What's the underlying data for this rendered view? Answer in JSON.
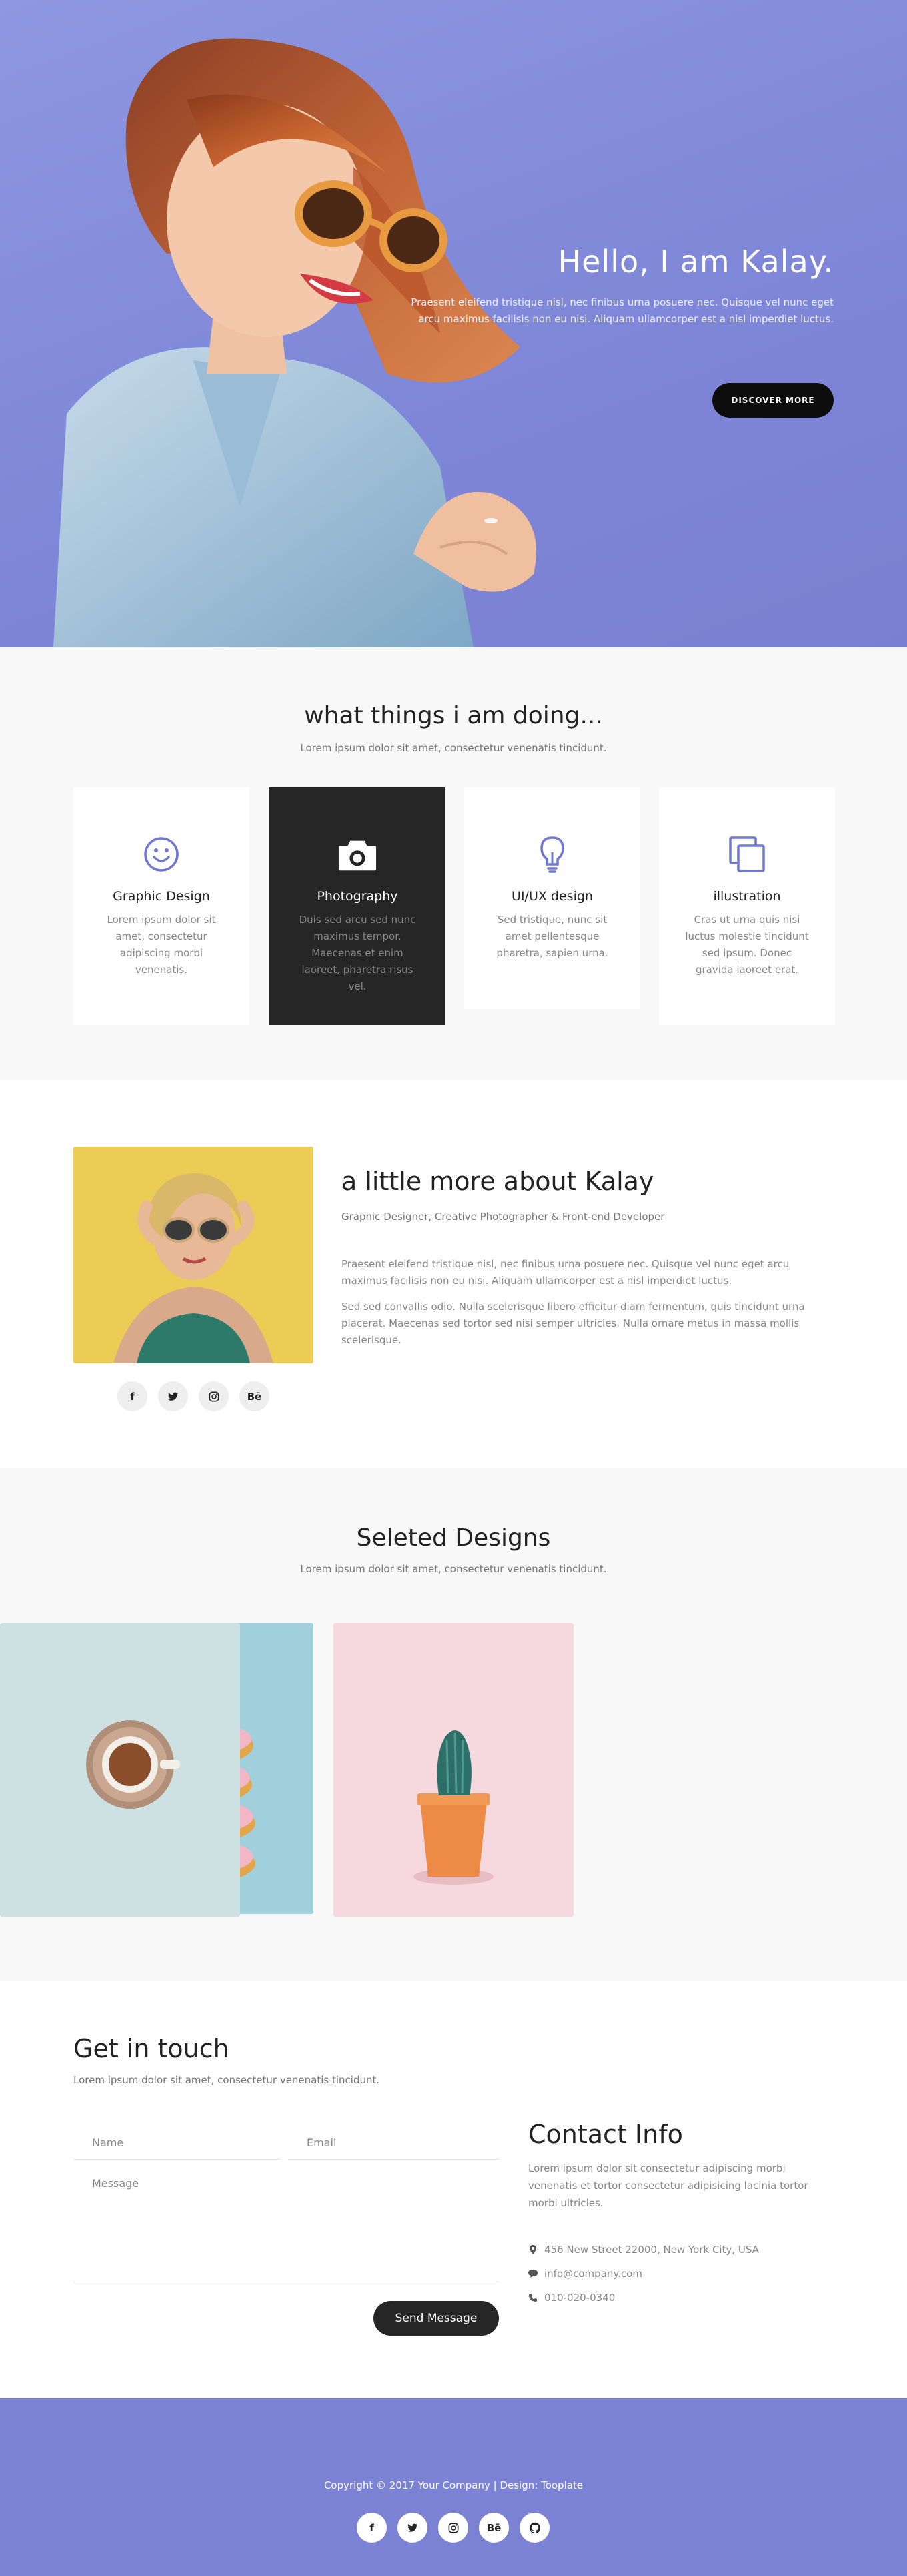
{
  "hero": {
    "title": "Hello, I am Kalay.",
    "description": "Praesent eleifend tristique nisl, nec finibus urna posuere nec. Quisque vel nunc eget arcu maximus facilisis non eu nisi. Aliquam ullamcorper est a nisl imperdiet luctus.",
    "button_label": "DISCOVER MORE",
    "background_color": "#8a91dc"
  },
  "services": {
    "title": "what things i am doing...",
    "subtitle": "Lorem ipsum dolor sit amet, consectetur venenatis tincidunt.",
    "cards": [
      {
        "icon": "smiley-icon",
        "title": "Graphic Design",
        "text": "Lorem ipsum dolor sit amet, consectetur adipiscing morbi venenatis."
      },
      {
        "icon": "camera-icon",
        "title": "Photography",
        "text": "Duis sed arcu sed nunc maximus tempor. Maecenas et enim laoreet, pharetra risus vel."
      },
      {
        "icon": "lightbulb-icon",
        "title": "UI/UX design",
        "text": "Sed tristique, nunc sit amet pellentesque pharetra, sapien urna."
      },
      {
        "icon": "copy-icon",
        "title": "illustration",
        "text": "Cras ut urna quis nisi luctus molestie tincidunt sed ipsum. Donec gravida laoreet erat."
      }
    ],
    "accent_color": "#6f78d0"
  },
  "about": {
    "title": "a little more about Kalay",
    "role": "Graphic Designer, Creative Photographer & Front-end Developer",
    "paragraphs": [
      "Praesent eleifend tristique nisl, nec finibus urna posuere nec. Quisque vel nunc eget arcu maximus facilisis non eu nisi. Aliquam ullamcorper est a nisl imperdiet luctus.",
      "Sed sed convallis odio. Nulla scelerisque libero efficitur diam fermentum, quis tincidunt urna placerat. Maecenas sed tortor sed nisi semper ultricies. Nulla ornare metus in massa mollis scelerisque."
    ],
    "social": [
      "f",
      "twitter-icon",
      "instagram-icon",
      "Bē"
    ]
  },
  "designs": {
    "title": "Seleted Designs",
    "subtitle": "Lorem ipsum dolor sit amet, consectetur venenatis tincidunt.",
    "items": [
      "donuts-image",
      "cactus-image",
      "coffee-cup-image"
    ]
  },
  "contact": {
    "title": "Get in touch",
    "subtitle": "Lorem ipsum dolor sit amet, consectetur venenatis tincidunt.",
    "name_placeholder": "Name",
    "email_placeholder": "Email",
    "message_placeholder": "Message",
    "send_label": "Send Message",
    "info_title": "Contact Info",
    "info_desc": "Lorem ipsum dolor sit consectetur adipiscing morbi venenatis et tortor consectetur adipisicing lacinia tortor morbi ultricies.",
    "address": "456 New Street 22000, New York City, USA",
    "email": "info@company.com",
    "phone": "010-020-0340"
  },
  "footer": {
    "copyright": "Copyright © 2017 Your Company | Design: Tooplate",
    "social": [
      "f",
      "twitter-icon",
      "instagram-icon",
      "Bē",
      "github-icon"
    ],
    "background_color": "#7b82d3"
  }
}
